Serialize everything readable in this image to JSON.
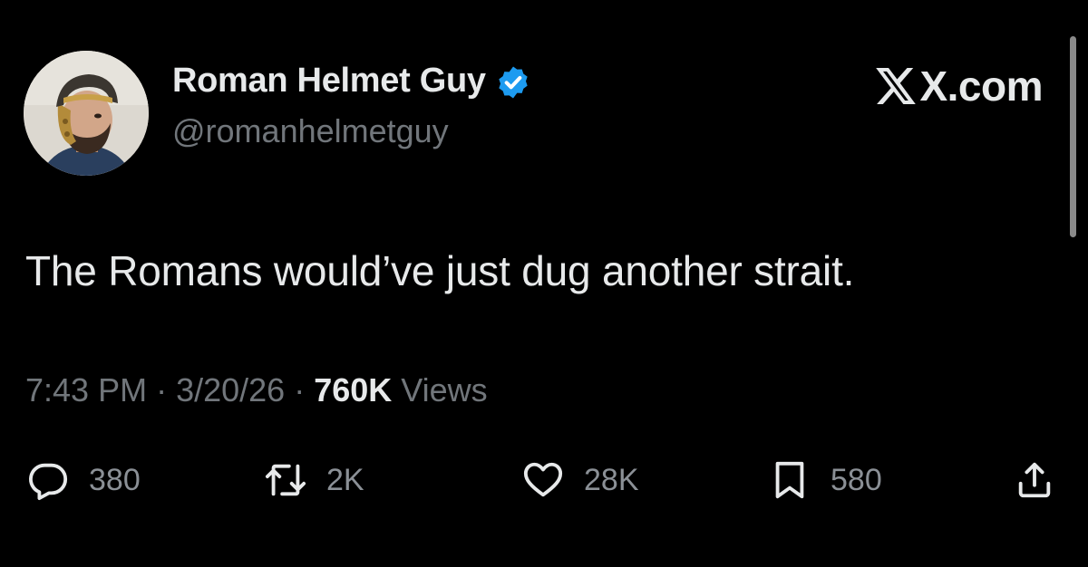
{
  "author": {
    "display_name": "Roman Helmet Guy",
    "handle": "@romanhelmetguy",
    "verified_icon": "verified-badge-icon",
    "avatar": "profile-avatar"
  },
  "watermark": {
    "text": "X.com",
    "icon": "x-logo-icon"
  },
  "tweet": {
    "text": "The Romans would’ve just dug another strait."
  },
  "meta": {
    "time": "7:43 PM",
    "separator": "·",
    "date": "3/20/26",
    "views_count": "760K",
    "views_label": "Views"
  },
  "actions": {
    "reply": {
      "icon": "reply-icon",
      "count": "380"
    },
    "retweet": {
      "icon": "retweet-icon",
      "count": "2K"
    },
    "like": {
      "icon": "heart-icon",
      "count": "28K"
    },
    "bookmark": {
      "icon": "bookmark-icon",
      "count": "580"
    },
    "share": {
      "icon": "share-icon"
    }
  },
  "colors": {
    "background": "#000000",
    "primary_text": "#e7e9ea",
    "secondary_text": "#71767b",
    "verified_blue": "#1d9bf0"
  }
}
